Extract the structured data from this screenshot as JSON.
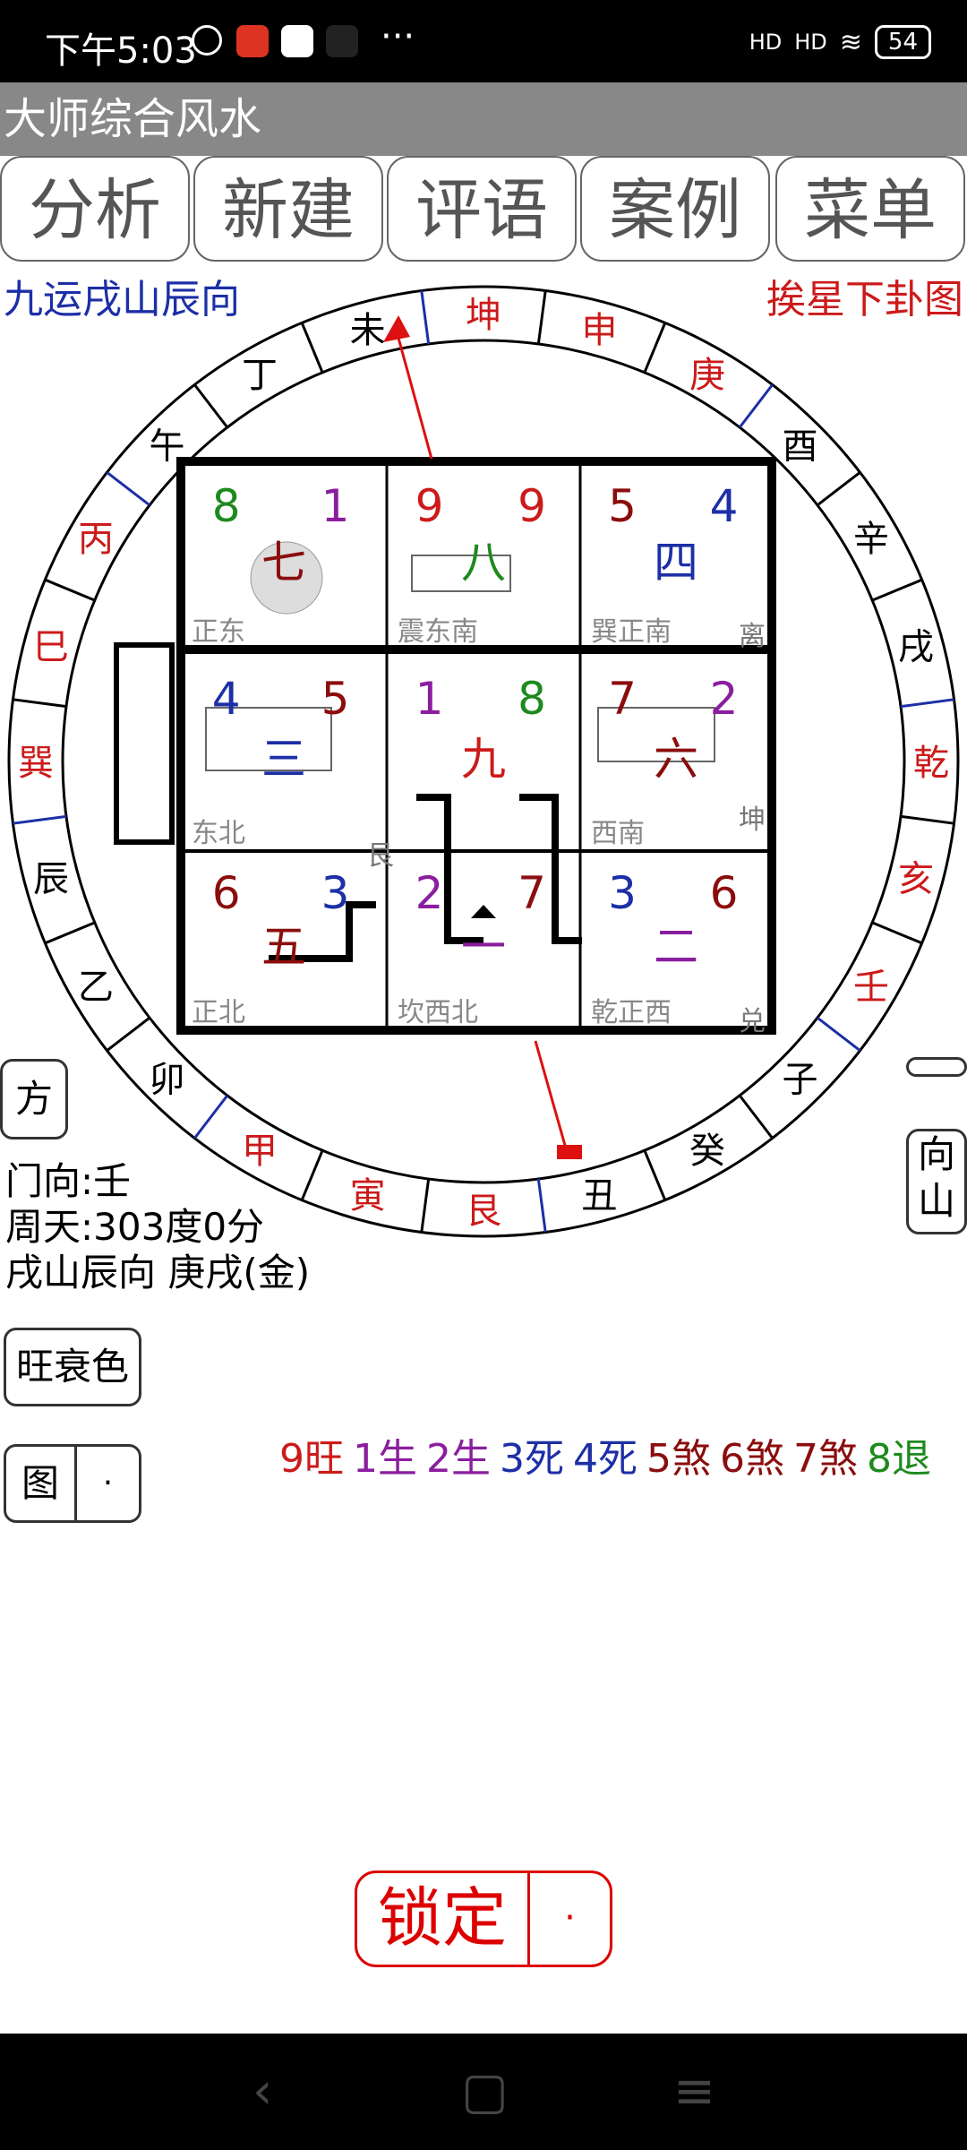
{
  "status": {
    "time": "下午5:03",
    "dots": "···",
    "net1": "HD",
    "net2": "HD",
    "battery": "54"
  },
  "app_title": "大师综合风水",
  "tabs": [
    "分析",
    "新建",
    "评语",
    "案例",
    "菜单"
  ],
  "header_left": "九运戌山辰向",
  "header_right": "挨星下卦图",
  "compass": {
    "ring": [
      "辰",
      "巽",
      "巳",
      "丙",
      "午",
      "丁",
      "未",
      "坤",
      "申",
      "庚",
      "酉",
      "辛",
      "戌",
      "乾",
      "亥",
      "壬",
      "子",
      "癸",
      "丑",
      "艮",
      "寅",
      "甲",
      "卯",
      "乙"
    ],
    "ring_colors": [
      "#000",
      "#cc1a1a",
      "#cc1a1a",
      "#cc1a1a",
      "#000",
      "#000",
      "#000",
      "#cc1a1a",
      "#cc1a1a",
      "#cc1a1a",
      "#000",
      "#000",
      "#000",
      "#cc1a1a",
      "#cc1a1a",
      "#cc1a1a",
      "#000",
      "#000",
      "#000",
      "#cc1a1a",
      "#cc1a1a",
      "#cc1a1a",
      "#000",
      "#000"
    ]
  },
  "palaces": [
    {
      "mountain": "8",
      "water": "1",
      "period": "七",
      "mc": "#1e8a1e",
      "wc": "#8a1e9e",
      "pc": "#8b0d0d",
      "name": "正东"
    },
    {
      "mountain": "9",
      "water": "9",
      "period": "八",
      "mc": "#cc1a1a",
      "wc": "#cc1a1a",
      "pc": "#1e8a1e",
      "name": "震东南"
    },
    {
      "mountain": "5",
      "water": "4",
      "period": "四",
      "mc": "#8b0d0d",
      "wc": "#1c2fa6",
      "pc": "#1c2fa6",
      "name": "巽正南"
    },
    {
      "mountain": "4",
      "water": "5",
      "period": "三",
      "mc": "#1c2fa6",
      "wc": "#8b0d0d",
      "pc": "#1c2fa6",
      "name": "东北"
    },
    {
      "mountain": "1",
      "water": "8",
      "period": "九",
      "mc": "#8a1e9e",
      "wc": "#1e8a1e",
      "pc": "#cc1a1a",
      "name": ""
    },
    {
      "mountain": "7",
      "water": "2",
      "period": "六",
      "mc": "#8b0d0d",
      "wc": "#8a1e9e",
      "pc": "#8b0d0d",
      "name": "西南"
    },
    {
      "mountain": "6",
      "water": "3",
      "period": "五",
      "mc": "#8b0d0d",
      "wc": "#1c2fa6",
      "pc": "#8b0d0d",
      "name": "正北"
    },
    {
      "mountain": "2",
      "water": "7",
      "period": "一",
      "mc": "#8a1e9e",
      "wc": "#8b0d0d",
      "pc": "#8a1e9e",
      "name": "坎西北"
    },
    {
      "mountain": "3",
      "water": "6",
      "period": "二",
      "mc": "#1c2fa6",
      "wc": "#8b0d0d",
      "pc": "#8a1e9e",
      "name": "乾正西"
    }
  ],
  "plan_labels": {
    "l_a": "艮",
    "l_b": "离",
    "l_c": "坤",
    "l_d": "兑"
  },
  "side": {
    "fang": "方",
    "dash": "一",
    "xiangshan": "向\n山",
    "wangshuai": "旺衰色",
    "tu": "图",
    "dot": "·"
  },
  "info": {
    "door": "门向:壬",
    "zhoutian": "周天:303度0分",
    "shan": "戌山辰向 庚戌(金)"
  },
  "legend": [
    {
      "text": "9旺",
      "color": "#cc1a1a"
    },
    {
      "text": "1生",
      "color": "#8a1e9e"
    },
    {
      "text": "2生",
      "color": "#8a1e9e"
    },
    {
      "text": "3死",
      "color": "#1c2fa6"
    },
    {
      "text": "4死",
      "color": "#1c2fa6"
    },
    {
      "text": "5煞",
      "color": "#8b0d0d"
    },
    {
      "text": "6煞",
      "color": "#8b0d0d"
    },
    {
      "text": "7煞",
      "color": "#8b0d0d"
    },
    {
      "text": "8退",
      "color": "#1e8a1e"
    }
  ],
  "lock": {
    "label": "锁定",
    "dot": "·"
  }
}
